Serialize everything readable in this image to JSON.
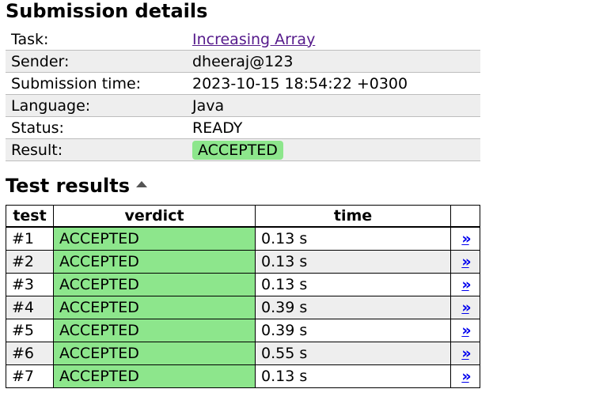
{
  "details": {
    "title": "Submission details",
    "rows": [
      {
        "key": "Task:",
        "value": "Increasing Array"
      },
      {
        "key": "Sender:",
        "value": "dheeraj@123"
      },
      {
        "key": "Submission time:",
        "value": "2023-10-15 18:54:22 +0300"
      },
      {
        "key": "Language:",
        "value": "Java"
      },
      {
        "key": "Status:",
        "value": "READY"
      },
      {
        "key": "Result:",
        "value": "ACCEPTED"
      }
    ]
  },
  "results": {
    "title": "Test results",
    "sort_icon": "sort-up-icon",
    "headers": {
      "test": "test",
      "verdict": "verdict",
      "time": "time"
    },
    "link_glyph": "»",
    "rows": [
      {
        "test": "#1",
        "verdict": "ACCEPTED",
        "time": "0.13 s"
      },
      {
        "test": "#2",
        "verdict": "ACCEPTED",
        "time": "0.13 s"
      },
      {
        "test": "#3",
        "verdict": "ACCEPTED",
        "time": "0.13 s"
      },
      {
        "test": "#4",
        "verdict": "ACCEPTED",
        "time": "0.39 s"
      },
      {
        "test": "#5",
        "verdict": "ACCEPTED",
        "time": "0.39 s"
      },
      {
        "test": "#6",
        "verdict": "ACCEPTED",
        "time": "0.55 s"
      },
      {
        "test": "#7",
        "verdict": "ACCEPTED",
        "time": "0.13 s"
      }
    ]
  },
  "colors": {
    "accepted": "#8de68c",
    "row_alt": "#eeeeee",
    "link": "#0000ee",
    "visited_link": "#551a8b"
  }
}
